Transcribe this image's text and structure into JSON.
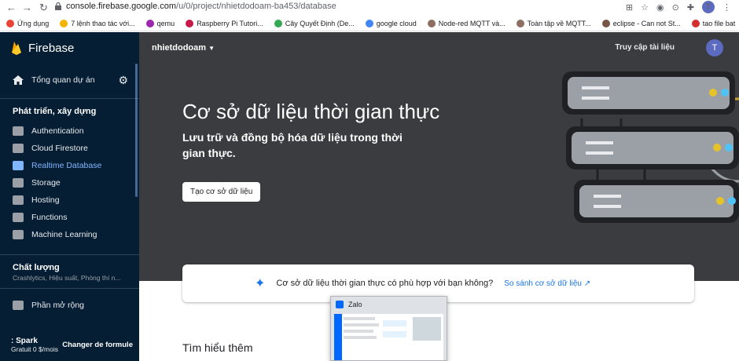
{
  "browser": {
    "url_host": "console.firebase.google.com",
    "url_path": "/u/0/project/nhietdodoam-ba453/database",
    "avatar_letter": "T",
    "bookmarks": [
      {
        "label": "Ứng dụng",
        "color": "#ea4335"
      },
      {
        "label": "7 lệnh thao tác với...",
        "color": "#f4b400"
      },
      {
        "label": "qemu",
        "color": "#9c27b0"
      },
      {
        "label": "Raspberry Pi Tutori...",
        "color": "#c51a4a"
      },
      {
        "label": "Cây Quyết Định (De...",
        "color": "#34a853"
      },
      {
        "label": "google cloud",
        "color": "#4285f4"
      },
      {
        "label": "Node-red MQTT và...",
        "color": "#8d6e63"
      },
      {
        "label": "Toàn tập về MQTT...",
        "color": "#8d6e63"
      },
      {
        "label": "eclipse - Can not St...",
        "color": "#795548"
      },
      {
        "label": "tao file bat",
        "color": "#d32f2f"
      }
    ]
  },
  "sidebar": {
    "brand": "Firebase",
    "overview": "Tổng quan dự án",
    "develop_heading": "Phát triển, xây dựng",
    "items": [
      {
        "label": "Authentication",
        "icon": "people-icon"
      },
      {
        "label": "Cloud Firestore",
        "icon": "firestore-icon"
      },
      {
        "label": "Realtime Database",
        "icon": "database-icon"
      },
      {
        "label": "Storage",
        "icon": "storage-icon"
      },
      {
        "label": "Hosting",
        "icon": "hosting-icon"
      },
      {
        "label": "Functions",
        "icon": "functions-icon"
      },
      {
        "label": "Machine Learning",
        "icon": "ml-icon"
      }
    ],
    "quality_heading": "Chất lượng",
    "quality_sub": "Crashlytics, Hiệu suất, Phòng thí n...",
    "extensions": "Phần mở rộng",
    "plan_name": ": Spark",
    "plan_price": "Gratuit 0 $/mois",
    "plan_change": "Changer de formule"
  },
  "header": {
    "project": "nhietdodoam",
    "docs": "Truy cập tài liệu",
    "avatar": "T"
  },
  "hero": {
    "title": "Cơ sở dữ liệu thời gian thực",
    "subtitle": "Lưu trữ và đồng bộ hóa dữ liệu trong thời gian thực.",
    "create_button": "Tạo cơ sở dữ liệu"
  },
  "compare": {
    "question": "Cơ sở dữ liệu thời gian thực có phù hợp với bạn không?",
    "link": "So sánh cơ sở dữ liệu"
  },
  "learn_more": "Tìm hiểu thêm",
  "zalo": {
    "title": "Zalo"
  },
  "colors": {
    "sidebar": "#051e34",
    "hero": "#3a3c40",
    "accent": "#81b6ff",
    "link": "#1a73e8"
  }
}
